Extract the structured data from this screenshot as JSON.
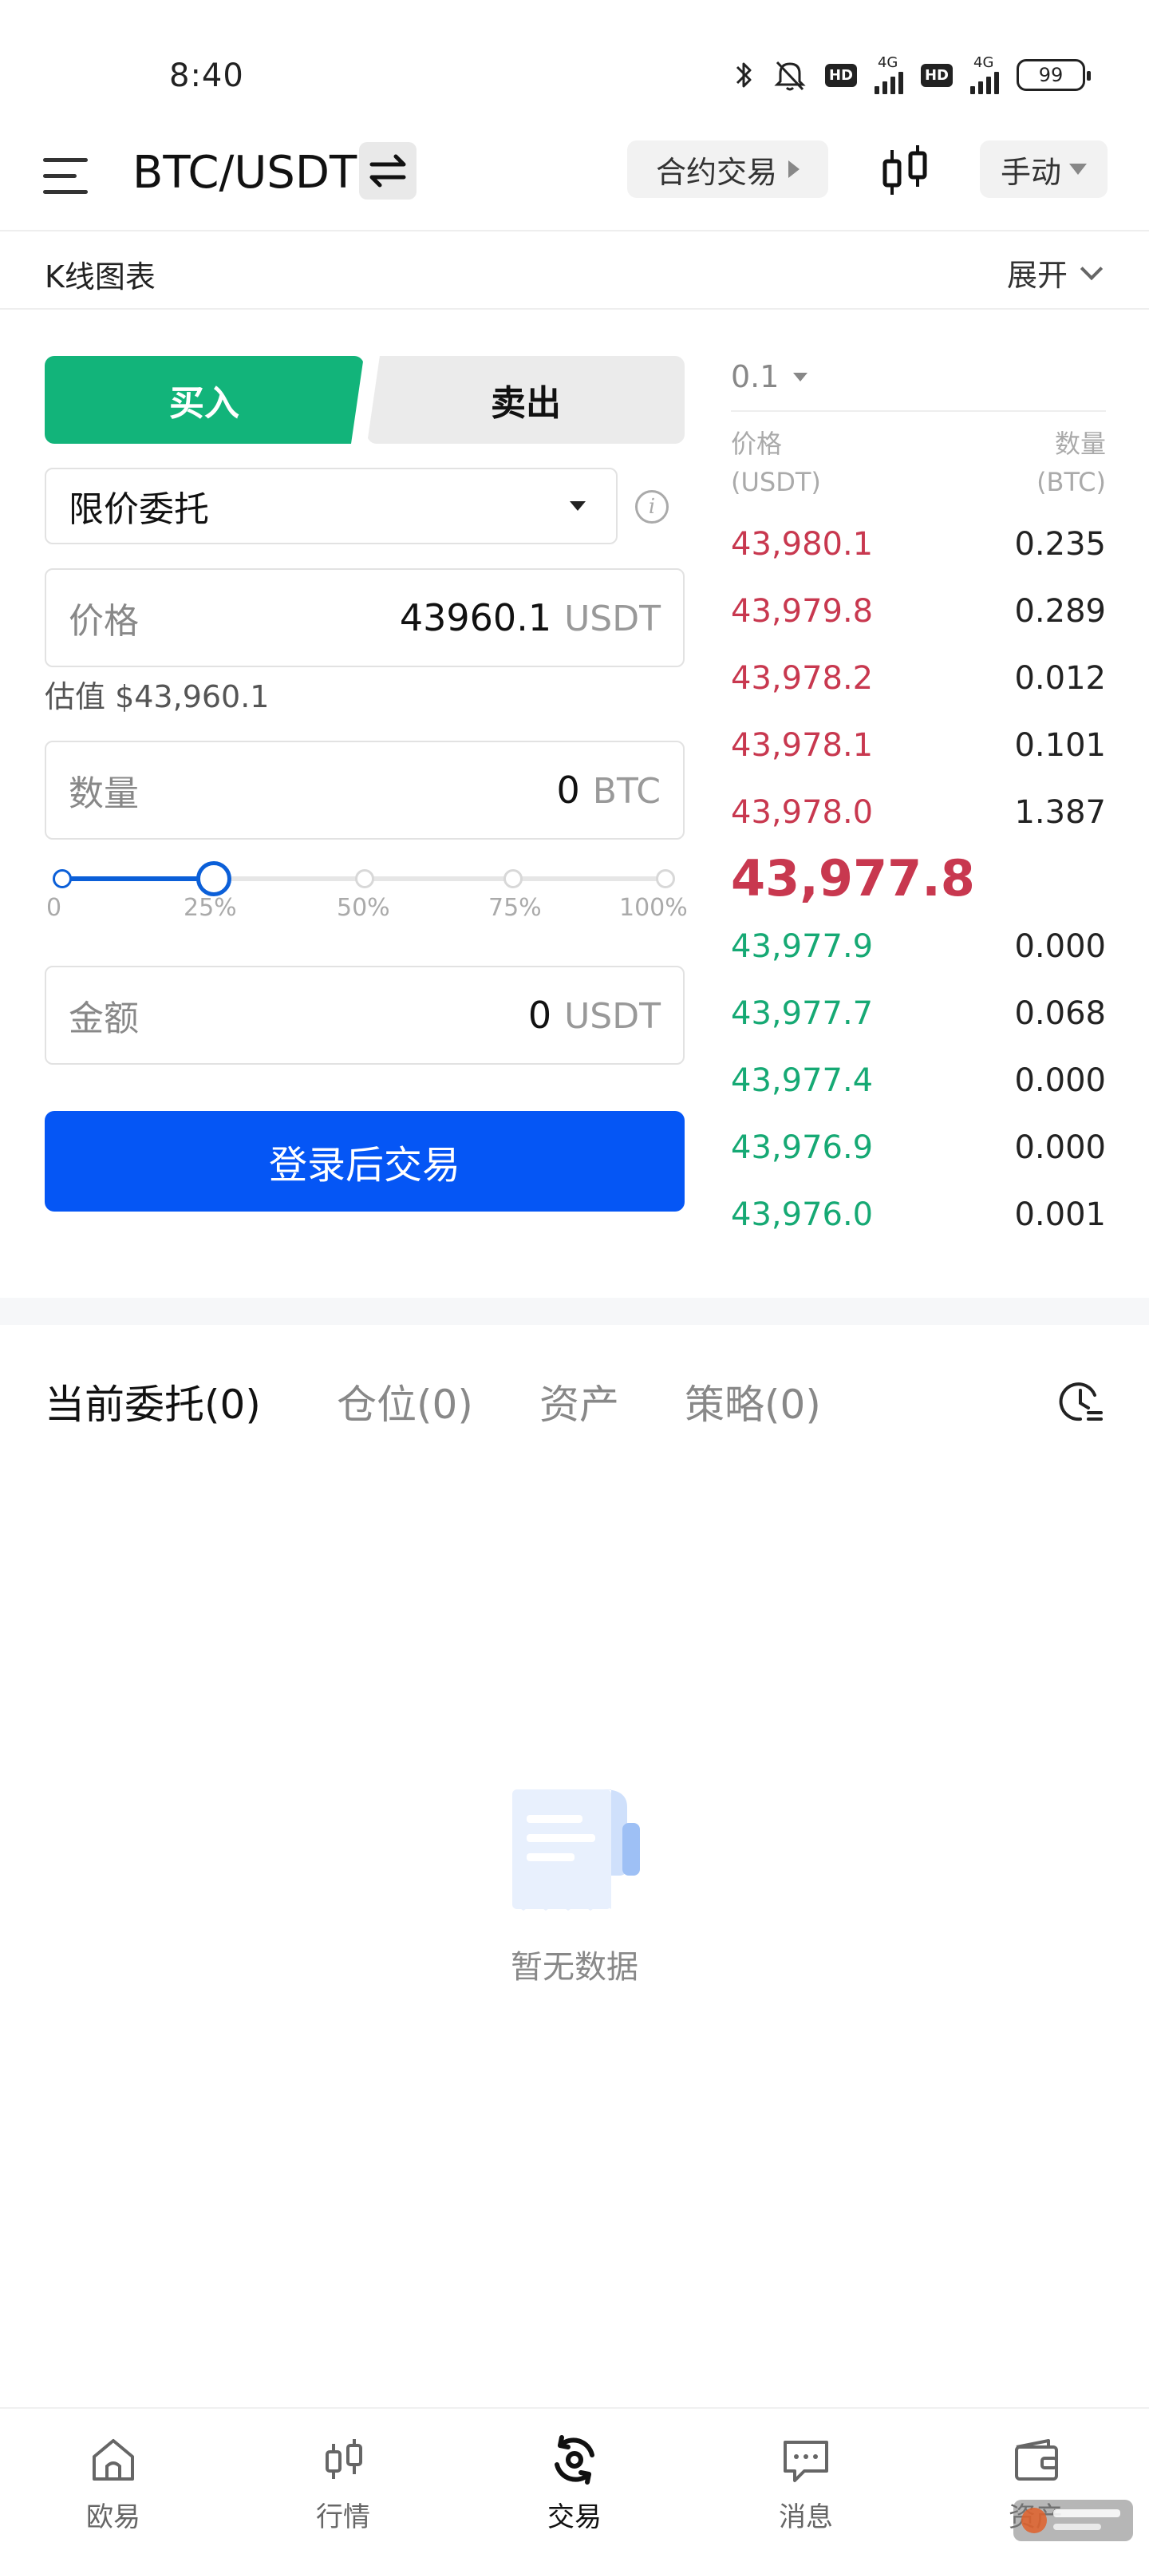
{
  "status_bar": {
    "time": "8:40",
    "network_1": "4G",
    "network_2": "4G",
    "hd_1": "HD",
    "hd_2": "HD",
    "battery": "99"
  },
  "header": {
    "pair": "BTC/USDT",
    "contract_label": "合约交易",
    "manual_label": "手动"
  },
  "kline": {
    "label": "K线图表",
    "expand_label": "展开"
  },
  "trade": {
    "buy_label": "买入",
    "sell_label": "卖出",
    "order_type": "限价委托",
    "price_label": "价格",
    "price_value": "43960.1",
    "price_unit": "USDT",
    "estimate": "估值 $43,960.1",
    "qty_label": "数量",
    "qty_value": "0",
    "qty_unit": "BTC",
    "slider_marks": [
      "0",
      "25%",
      "50%",
      "75%",
      "100%"
    ],
    "slider_value_percent": 25,
    "amount_label": "金额",
    "amount_value": "0",
    "amount_unit": "USDT",
    "submit_label": "登录后交易"
  },
  "order_book": {
    "precision": "0.1",
    "price_header": "价格",
    "price_header_unit": "(USDT)",
    "qty_header": "数量",
    "qty_header_unit": "(BTC)",
    "asks": [
      {
        "price": "43,980.1",
        "qty": "0.235"
      },
      {
        "price": "43,979.8",
        "qty": "0.289"
      },
      {
        "price": "43,978.2",
        "qty": "0.012"
      },
      {
        "price": "43,978.1",
        "qty": "0.101"
      },
      {
        "price": "43,978.0",
        "qty": "1.387"
      }
    ],
    "last_price": "43,977.8",
    "bids": [
      {
        "price": "43,977.9",
        "qty": "0.000"
      },
      {
        "price": "43,977.7",
        "qty": "0.068"
      },
      {
        "price": "43,977.4",
        "qty": "0.000"
      },
      {
        "price": "43,976.9",
        "qty": "0.000"
      },
      {
        "price": "43,976.0",
        "qty": "0.001"
      }
    ]
  },
  "orders": {
    "tabs": [
      "当前委托(0)",
      "仓位(0)",
      "资产",
      "策略(0)"
    ],
    "empty_text": "暂无数据"
  },
  "bottom_nav": {
    "items": [
      "欧易",
      "行情",
      "交易",
      "消息",
      "资产"
    ],
    "active": "交易"
  },
  "colors": {
    "buy_green": "#12b47a",
    "ask_red": "#c8384f",
    "bid_green": "#16a974",
    "primary_blue": "#0556f5"
  }
}
